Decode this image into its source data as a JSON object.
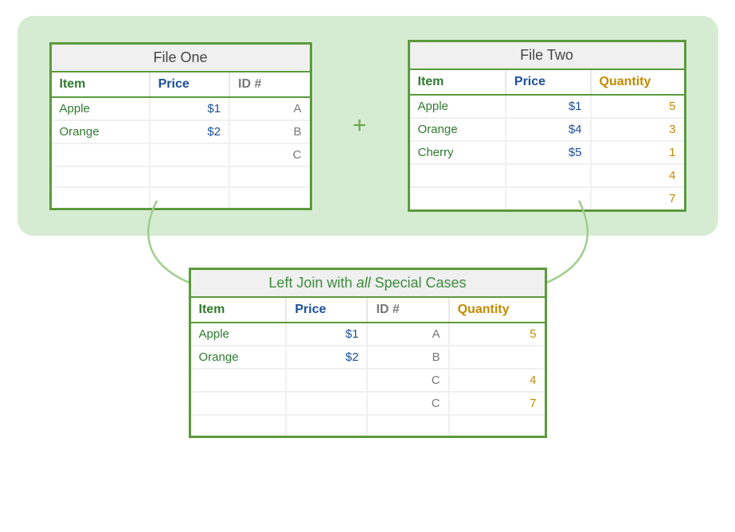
{
  "plus_symbol": "+",
  "table1": {
    "title": "File One",
    "headers": {
      "item": "Item",
      "price": "Price",
      "id": "ID #"
    },
    "rows": [
      {
        "item": "Apple",
        "price": "$1",
        "id": "A"
      },
      {
        "item": "Orange",
        "price": "$2",
        "id": "B"
      },
      {
        "item": "",
        "price": "",
        "id": "C"
      },
      {
        "item": "",
        "price": "",
        "id": ""
      },
      {
        "item": "",
        "price": "",
        "id": ""
      }
    ]
  },
  "table2": {
    "title": "File Two",
    "headers": {
      "item": "Item",
      "price": "Price",
      "qty": "Quantity"
    },
    "rows": [
      {
        "item": "Apple",
        "price": "$1",
        "qty": "5"
      },
      {
        "item": "Orange",
        "price": "$4",
        "qty": "3"
      },
      {
        "item": "Cherry",
        "price": "$5",
        "qty": "1"
      },
      {
        "item": "",
        "price": "",
        "qty": "4"
      },
      {
        "item": "",
        "price": "",
        "qty": "7"
      }
    ]
  },
  "table3": {
    "title_pre": "Left Join with ",
    "title_em": "all",
    "title_post": " Special Cases",
    "headers": {
      "item": "Item",
      "price": "Price",
      "id": "ID #",
      "qty": "Quantity"
    },
    "rows": [
      {
        "item": "Apple",
        "price": "$1",
        "id": "A",
        "qty": "5"
      },
      {
        "item": "Orange",
        "price": "$2",
        "id": "B",
        "qty": ""
      },
      {
        "item": "",
        "price": "",
        "id": "C",
        "qty": "4"
      },
      {
        "item": "",
        "price": "",
        "id": "C",
        "qty": "7"
      },
      {
        "item": "",
        "price": "",
        "id": "",
        "qty": ""
      }
    ]
  },
  "chart_data": {
    "type": "table",
    "description": "Diagram showing a left join operation between two data files",
    "file_one": {
      "columns": [
        "Item",
        "Price",
        "ID #"
      ],
      "data": [
        [
          "Apple",
          "$1",
          "A"
        ],
        [
          "Orange",
          "$2",
          "B"
        ],
        [
          "",
          "",
          "C"
        ]
      ]
    },
    "file_two": {
      "columns": [
        "Item",
        "Price",
        "Quantity"
      ],
      "data": [
        [
          "Apple",
          "$1",
          5
        ],
        [
          "Orange",
          "$4",
          3
        ],
        [
          "Cherry",
          "$5",
          1
        ],
        [
          "",
          "",
          4
        ],
        [
          "",
          "",
          7
        ]
      ]
    },
    "result": {
      "title": "Left Join with all Special Cases",
      "columns": [
        "Item",
        "Price",
        "ID #",
        "Quantity"
      ],
      "data": [
        [
          "Apple",
          "$1",
          "A",
          5
        ],
        [
          "Orange",
          "$2",
          "B",
          ""
        ],
        [
          "",
          "",
          "C",
          4
        ],
        [
          "",
          "",
          "C",
          7
        ]
      ]
    }
  }
}
